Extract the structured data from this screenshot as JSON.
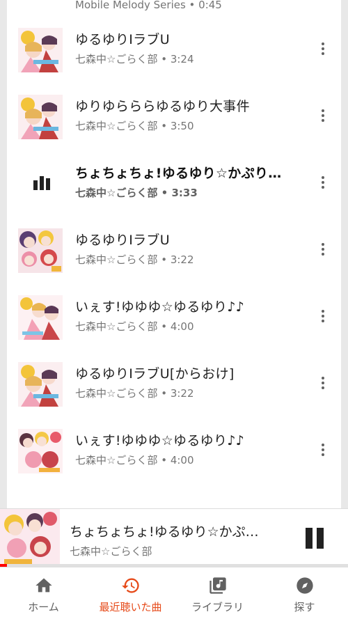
{
  "header_partial": {
    "subtitle": "Mobile Melody Series • 0:45"
  },
  "songs": [
    {
      "title": "ゆるゆりIラブU",
      "sub": "七森中☆ごらく部 • 3:24",
      "art": "a"
    },
    {
      "title": "ゆりゆらららゆるゆり大事件",
      "sub": "七森中☆ごらく部 • 3:50",
      "art": "a"
    },
    {
      "title": "ちょちょちょ!ゆるゆり☆かぷり…",
      "sub": "七森中☆ごらく部 • 3:33",
      "art": "playing"
    },
    {
      "title": "ゆるゆりIラブU",
      "sub": "七森中☆ごらく部 • 3:22",
      "art": "b"
    },
    {
      "title": "いぇす!ゆゆゆ☆ゆるゆり♪♪",
      "sub": "七森中☆ごらく部 • 4:00",
      "art": "c"
    },
    {
      "title": "ゆるゆりIラブU[からおけ]",
      "sub": "七森中☆ごらく部 • 3:22",
      "art": "a"
    },
    {
      "title": "いぇす!ゆゆゆ☆ゆるゆり♪♪",
      "sub": "七森中☆ごらく部 • 4:00",
      "art": "d"
    }
  ],
  "now_playing": {
    "title": "ちょちょちょ!ゆるゆり☆かぷ…",
    "artist": "七森中☆ごらく部",
    "progress": 0.02
  },
  "nav": {
    "home": "ホーム",
    "recent": "最近聴いた曲",
    "library": "ライブラリ",
    "explore": "探す",
    "active": "recent"
  },
  "colors": {
    "accent": "#e64a19",
    "progress": "#ff0000"
  }
}
